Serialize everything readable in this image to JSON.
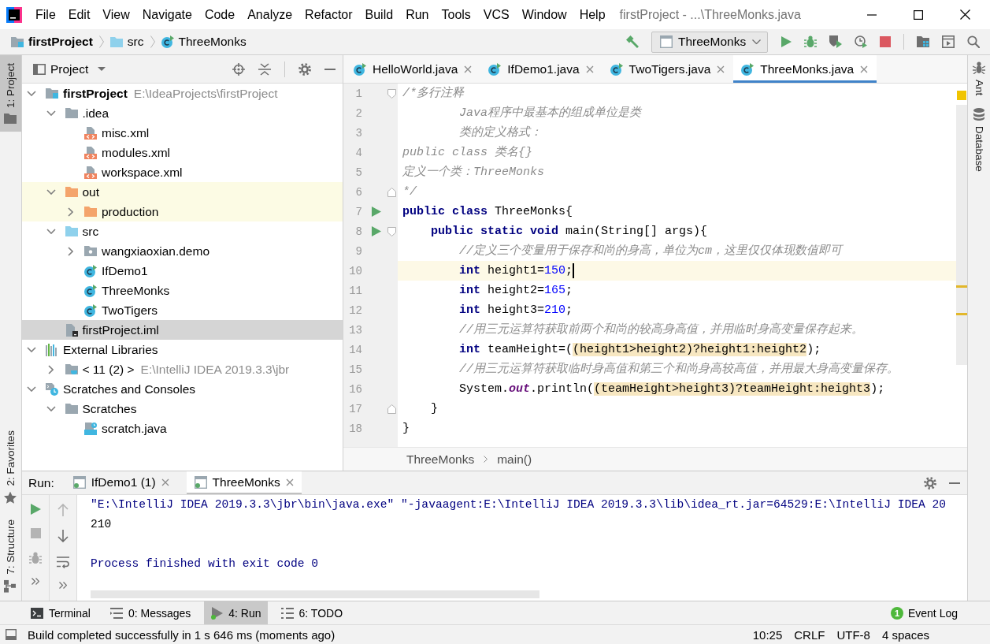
{
  "window": {
    "title": "firstProject - ...\\ThreeMonks.java"
  },
  "menu": [
    "File",
    "Edit",
    "View",
    "Navigate",
    "Code",
    "Analyze",
    "Refactor",
    "Build",
    "Run",
    "Tools",
    "VCS",
    "Window",
    "Help"
  ],
  "navigation_bar": {
    "breadcrumbs": [
      {
        "label": "firstProject",
        "kind": "project"
      },
      {
        "label": "src",
        "kind": "source-folder"
      },
      {
        "label": "ThreeMonks",
        "kind": "class"
      }
    ],
    "run_configuration": "ThreeMonks"
  },
  "left_stripe": [
    {
      "label": "1: Project",
      "kind": "project",
      "selected": true
    },
    {
      "label": "2: Favorites",
      "kind": "favorites",
      "selected": false
    },
    {
      "label": "7: Structure",
      "kind": "structure",
      "selected": false
    }
  ],
  "right_stripe": [
    {
      "label": "Ant",
      "kind": "ant"
    },
    {
      "label": "Database",
      "kind": "database"
    }
  ],
  "project_panel": {
    "title": "Project",
    "tree": [
      {
        "label": "firstProject",
        "path": "E:\\IdeaProjects\\firstProject",
        "kind": "project",
        "expanded": true,
        "selected": false,
        "highlighted": false,
        "children": [
          {
            "label": ".idea",
            "kind": "folder",
            "expanded": true,
            "selected": false,
            "highlighted": false,
            "children": [
              {
                "label": "misc.xml",
                "kind": "xml",
                "selected": false,
                "highlighted": false
              },
              {
                "label": "modules.xml",
                "kind": "xml",
                "selected": false,
                "highlighted": false
              },
              {
                "label": "workspace.xml",
                "kind": "xml",
                "selected": false,
                "highlighted": false
              }
            ]
          },
          {
            "label": "out",
            "kind": "excluded-folder",
            "expanded": true,
            "selected": false,
            "highlighted": true,
            "children": [
              {
                "label": "production",
                "kind": "excluded-folder",
                "expanded": false,
                "selected": false,
                "highlighted": true
              }
            ]
          },
          {
            "label": "src",
            "kind": "source-folder",
            "expanded": true,
            "selected": false,
            "highlighted": false,
            "children": [
              {
                "label": "wangxiaoxian.demo",
                "kind": "package",
                "expanded": false,
                "selected": false,
                "highlighted": false
              },
              {
                "label": "IfDemo1",
                "kind": "class",
                "selected": false,
                "highlighted": false
              },
              {
                "label": "ThreeMonks",
                "kind": "class",
                "selected": false,
                "highlighted": false
              },
              {
                "label": "TwoTigers",
                "kind": "class",
                "selected": false,
                "highlighted": false
              }
            ]
          },
          {
            "label": "firstProject.iml",
            "kind": "module-file",
            "selected": true,
            "highlighted": false
          }
        ]
      },
      {
        "label": "External Libraries",
        "kind": "libraries",
        "expanded": true,
        "selected": false,
        "highlighted": false,
        "children": [
          {
            "label": "< 11 (2) >",
            "path": "E:\\IntelliJ IDEA 2019.3.3\\jbr",
            "kind": "jdk",
            "expanded": false,
            "selected": false,
            "highlighted": false
          }
        ]
      },
      {
        "label": "Scratches and Consoles",
        "kind": "scratches",
        "expanded": true,
        "selected": false,
        "highlighted": false,
        "children": [
          {
            "label": "Scratches",
            "kind": "folder",
            "expanded": true,
            "selected": false,
            "highlighted": false,
            "children": [
              {
                "label": "scratch.java",
                "kind": "java-file",
                "selected": false,
                "highlighted": false
              }
            ]
          }
        ]
      }
    ]
  },
  "editor": {
    "tabs": [
      {
        "label": "HelloWorld.java",
        "selected": false
      },
      {
        "label": "IfDemo1.java",
        "selected": false
      },
      {
        "label": "TwoTigers.java",
        "selected": false
      },
      {
        "label": "ThreeMonks.java",
        "selected": true
      }
    ],
    "lines": [
      {
        "number": "1",
        "current": false,
        "gutter": [
          {
            "kind": "fold-start"
          }
        ],
        "tokens": [
          {
            "kind": "comment",
            "text": "/*多行注释"
          }
        ]
      },
      {
        "number": "2",
        "current": false,
        "tokens": [
          {
            "kind": "comment",
            "text": "        Java程序中最基本的组成单位是类"
          }
        ]
      },
      {
        "number": "3",
        "current": false,
        "tokens": [
          {
            "kind": "comment",
            "text": "        类的定义格式："
          }
        ]
      },
      {
        "number": "4",
        "current": false,
        "tokens": [
          {
            "kind": "comment",
            "text": "public class 类名{}"
          }
        ]
      },
      {
        "number": "5",
        "current": false,
        "tokens": [
          {
            "kind": "comment",
            "text": "定义一个类：ThreeMonks"
          }
        ]
      },
      {
        "number": "6",
        "current": false,
        "gutter": [
          {
            "kind": "fold-end"
          }
        ],
        "tokens": [
          {
            "kind": "comment",
            "text": "*/"
          }
        ]
      },
      {
        "number": "7",
        "current": false,
        "gutter": [
          {
            "kind": "run"
          }
        ],
        "tokens": [
          {
            "kind": "keyword",
            "text": "public class"
          },
          {
            "kind": "plain",
            "text": " ThreeMonks{"
          }
        ]
      },
      {
        "number": "8",
        "current": false,
        "gutter": [
          {
            "kind": "run"
          },
          {
            "kind": "fold-start"
          }
        ],
        "tokens": [
          {
            "kind": "keyword",
            "text": "    public static void"
          },
          {
            "kind": "plain",
            "text": " main(String[] args){"
          }
        ]
      },
      {
        "number": "9",
        "current": false,
        "tokens": [
          {
            "kind": "comment",
            "text": "        //定义三个变量用于保存和尚的身高，单位为cm，这里仅仅体现数值即可"
          }
        ]
      },
      {
        "number": "10",
        "current": true,
        "tokens": [
          {
            "kind": "keyword",
            "text": "        int"
          },
          {
            "kind": "plain",
            "text": " height1="
          },
          {
            "kind": "number",
            "text": "150"
          },
          {
            "kind": "plain",
            "text": ";"
          }
        ]
      },
      {
        "number": "11",
        "current": false,
        "tokens": [
          {
            "kind": "keyword",
            "text": "        int"
          },
          {
            "kind": "plain",
            "text": " height2="
          },
          {
            "kind": "number",
            "text": "165"
          },
          {
            "kind": "plain",
            "text": ";"
          }
        ]
      },
      {
        "number": "12",
        "current": false,
        "tokens": [
          {
            "kind": "keyword",
            "text": "        int"
          },
          {
            "kind": "plain",
            "text": " height3="
          },
          {
            "kind": "number",
            "text": "210"
          },
          {
            "kind": "plain",
            "text": ";"
          }
        ]
      },
      {
        "number": "13",
        "current": false,
        "tokens": [
          {
            "kind": "comment",
            "text": "        //用三元运算符获取前两个和尚的较高身高值，并用临时身高变量保存起来。"
          }
        ]
      },
      {
        "number": "14",
        "current": false,
        "tokens": [
          {
            "kind": "keyword",
            "text": "        int"
          },
          {
            "kind": "plain",
            "text": " teamHeight=("
          },
          {
            "kind": "match",
            "text": "(height1>height2)?height1:height2"
          },
          {
            "kind": "plain",
            "text": ");"
          }
        ]
      },
      {
        "number": "15",
        "current": false,
        "tokens": [
          {
            "kind": "comment",
            "text": "        //用三元运算符获取临时身高值和第三个和尚身高较高值，并用最大身高变量保存。"
          }
        ]
      },
      {
        "number": "16",
        "current": false,
        "tokens": [
          {
            "kind": "plain",
            "text": "        System."
          },
          {
            "kind": "static-field",
            "text": "out"
          },
          {
            "kind": "plain",
            "text": ".println("
          },
          {
            "kind": "match",
            "text": "(teamHeight>height3)?teamHeight:height3"
          },
          {
            "kind": "plain",
            "text": ");"
          }
        ]
      },
      {
        "number": "17",
        "current": false,
        "gutter": [
          {
            "kind": "fold-end"
          }
        ],
        "tokens": [
          {
            "kind": "plain",
            "text": "    }"
          }
        ]
      },
      {
        "number": "18",
        "current": false,
        "tokens": [
          {
            "kind": "plain",
            "text": "}"
          }
        ]
      }
    ],
    "breadcrumbs": [
      "ThreeMonks",
      "main()"
    ]
  },
  "run_panel": {
    "title": "Run:",
    "tabs": [
      {
        "label": "IfDemo1 (1)",
        "selected": false
      },
      {
        "label": "ThreeMonks",
        "selected": true
      }
    ],
    "console": [
      {
        "kind": "command",
        "text": "\"E:\\IntelliJ IDEA 2019.3.3\\jbr\\bin\\java.exe\" \"-javaagent:E:\\IntelliJ IDEA 2019.3.3\\lib\\idea_rt.jar=64529:E:\\IntelliJ IDEA 20"
      },
      {
        "kind": "output",
        "text": "210"
      },
      {
        "kind": "system",
        "text": "Process finished with exit code 0"
      }
    ]
  },
  "tool_window_bar": {
    "items": [
      {
        "label": "Terminal",
        "kind": "terminal",
        "selected": false
      },
      {
        "label": "0: Messages",
        "kind": "messages",
        "selected": false
      },
      {
        "label": "4: Run",
        "kind": "run",
        "selected": true
      },
      {
        "label": "6: TODO",
        "kind": "todo",
        "selected": false
      }
    ],
    "event_log": {
      "label": "Event Log",
      "count": "1"
    }
  },
  "status_bar": {
    "message": "Build completed successfully in 1 s 646 ms (moments ago)",
    "items": [
      "10:25",
      "CRLF",
      "UTF-8",
      "4 spaces"
    ]
  }
}
